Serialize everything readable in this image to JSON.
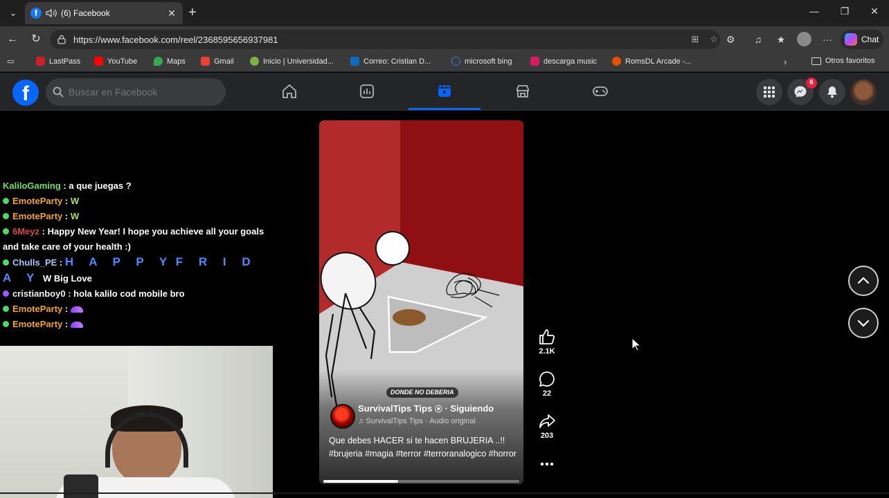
{
  "browser": {
    "tab_title": "(6) Facebook",
    "url": "https://www.facebook.com/reel/2368595656937981",
    "chat_label": "Chat",
    "bookmarks": [
      "LastPass",
      "YouTube",
      "Maps",
      "Gmail",
      "Inicio | Universidad...",
      "Correo: Cristian D...",
      "microsoft bing",
      "descarga music",
      "RomsDL Arcade -..."
    ],
    "other_favorites": "Otros favoritos",
    "colors": {
      "tab_bar": "#1f1f1f",
      "toolbar": "#3a3a3a"
    }
  },
  "facebook": {
    "search_placeholder": "Buscar en Facebook",
    "nav_items": [
      "home-icon",
      "video-icon",
      "reels-icon",
      "marketplace-icon",
      "gaming-icon"
    ],
    "active_nav": "reels-icon",
    "messenger_badge": "6",
    "accent": "#0866ff"
  },
  "stream_chat": {
    "messages": [
      {
        "user": "KaliloGaming",
        "text": ": a que juegas ?"
      },
      {
        "user": "EmoteParty",
        "text": ":",
        "emote": "W"
      },
      {
        "user": "EmoteParty",
        "text": ":",
        "emote": "W"
      },
      {
        "user": "6Meyz",
        "text": ": Happy New Year! I hope you achieve all your goals and take care of your health :)"
      },
      {
        "user": "Chulls_PE",
        "text": ":",
        "letters": "H A P P Y",
        "letters2": "F R I D A Y",
        "tail": "W Big Love"
      },
      {
        "user": "cristianboy0",
        "text": ": hola kalilo cod mobile bro"
      },
      {
        "user": "EmoteParty",
        "text": ":"
      },
      {
        "user": "EmoteParty",
        "text": ":"
      }
    ]
  },
  "reel": {
    "overlay_tag": "DONDE NO DEBERIA",
    "author": "SurvivalTips Tips",
    "following": "· Siguiendo",
    "audio": "SurvivalTips Tips · Audio original",
    "description": "Que debes HACER si te hacen BRUJERIA ..!! #brujeria #magia #terror #terroranalogico #horror",
    "progress": 0.38,
    "likes": "2.1K",
    "comments": "22",
    "shares": "203"
  }
}
